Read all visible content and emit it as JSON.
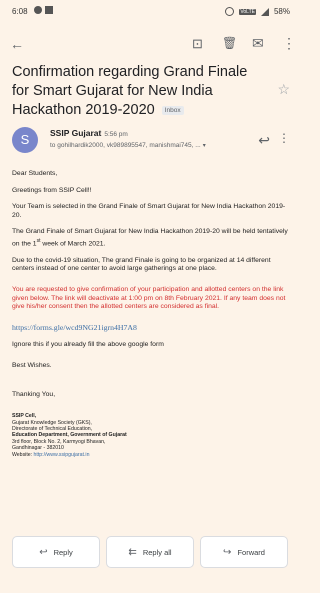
{
  "status": {
    "time": "6:08",
    "volte": "VoLTE",
    "battery": "58%"
  },
  "appbar": {
    "back_icon": "←",
    "archive_icon": "⊡",
    "delete_icon": "🗑",
    "mail_icon": "✉",
    "more_icon": "⋮"
  },
  "email": {
    "subject": "Confirmation regarding Grand Finale for Smart Gujarat for New India Hackathon 2019-2020",
    "label": "Inbox",
    "sender": {
      "initial": "S",
      "name": "SSIP Gujarat",
      "time": "5:56 pm",
      "recipients": "to gohilhardik2000, vk989895547, manishmai745, ..."
    },
    "body": {
      "greeting": "Dear Students,",
      "line1": "Greetings from SSIP Cell!!",
      "line2": "Your Team is selected in the Grand Finale of Smart Gujarat for New India Hackathon 2019-20.",
      "line3_a": "The Grand Finale of Smart Gujarat for New India Hackathon 2019-20 will be held tentatively on the 1",
      "line3_sup": "st",
      "line3_b": " week of March 2021.",
      "line4": "Due to the covid-19 situation, The grand Finale is going to be organized at 14 different centers instead of one center to avoid large gatherings at one place.",
      "red": "You are requested to give confirmation of your participation and allotted centers on the link given below. The link will deactivate at 1:00 pm on 8th February 2021. If any team does not give his/her consent then the allotted centers are considered as final.",
      "link": "https://forms.gle/wcd9NG21igrn4H7A8",
      "line5": "Ignore this if you already fill the above google form",
      "wishes": "Best Wishes.",
      "thanks": "Thanking You,"
    },
    "signature": {
      "l1": "SSIP Cell,",
      "l2": "Gujarat Knowledge Society (GKS),",
      "l3": "Directorate of Technical Education,",
      "l4": "Education Department, Government of Gujarat",
      "l5": "3rd floor, Block No. 2, Karmyogi Bhavan,",
      "l6": "Gandhinagar - 382010",
      "l7_label": "Website: ",
      "l7_url": "http://www.ssipgujarat.in"
    }
  },
  "actions": {
    "reply": "Reply",
    "reply_all": "Reply all",
    "forward": "Forward"
  }
}
